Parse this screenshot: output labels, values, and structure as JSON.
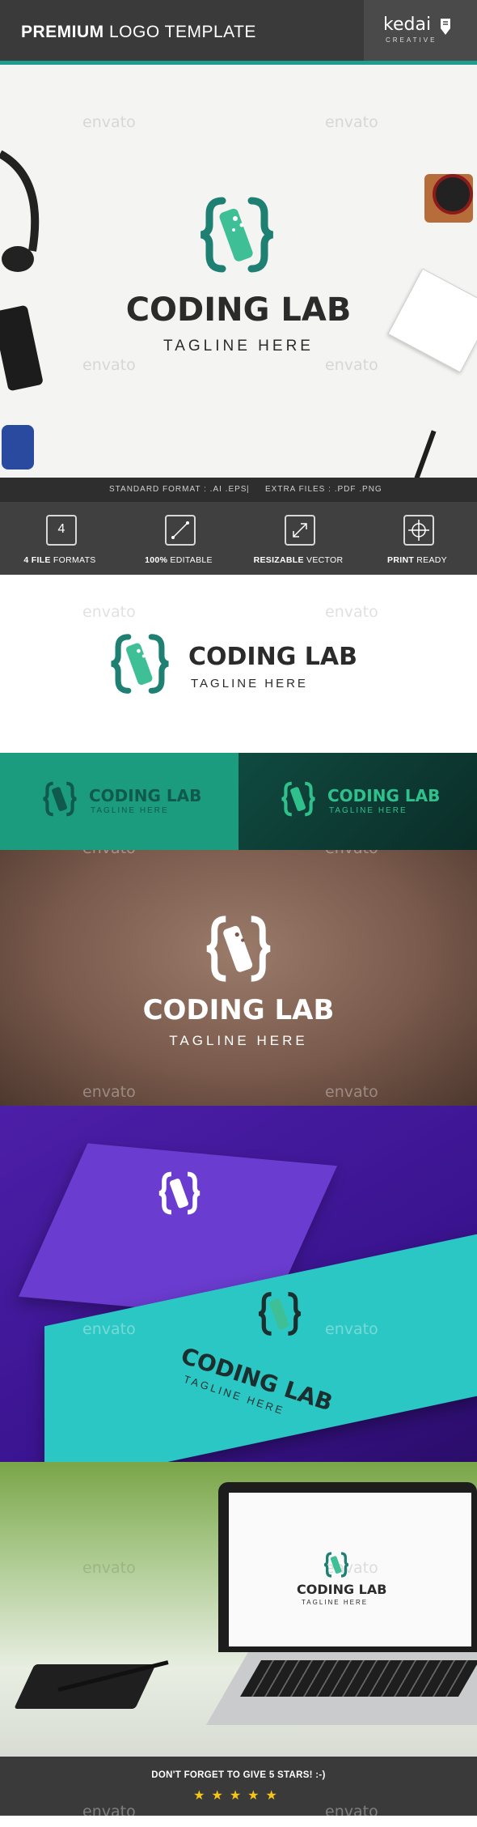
{
  "header": {
    "title_bold": "PREMIUM",
    "title_rest": " LOGO TEMPLATE",
    "brand": "kedai",
    "brand_sub": "CREATIVE"
  },
  "watermark": "envato",
  "logo": {
    "name": "CODING LAB",
    "tagline": "TAGLINE HERE"
  },
  "formats": {
    "standard_label": "STANDARD FORMAT : ",
    "standard_value": ".AI .EPS",
    "separator": "|",
    "extra_label": "EXTRA FILES : ",
    "extra_value": ".PDF .PNG"
  },
  "features": [
    {
      "bold": "4 FILE",
      "rest": " FORMATS",
      "icon": "file-formats-icon",
      "icon_text": "4"
    },
    {
      "bold": "100%",
      "rest": " EDITABLE",
      "icon": "pen-tool-icon"
    },
    {
      "bold": "RESIZABLE",
      "rest": " VECTOR",
      "icon": "resize-icon"
    },
    {
      "bold": "PRINT",
      "rest": " READY",
      "icon": "crosshair-icon"
    }
  ],
  "footer": {
    "message": "DON'T FORGET TO GIVE 5 STARS! :-)",
    "stars": "★★★★★"
  },
  "colors": {
    "teal": "#1e9c8e",
    "teal_light": "#5fcf9b",
    "dark": "#2b2b2b",
    "header_bg": "#3a3a3a",
    "purple": "#4d1fa8",
    "cyan_card": "#2bc7c4"
  }
}
